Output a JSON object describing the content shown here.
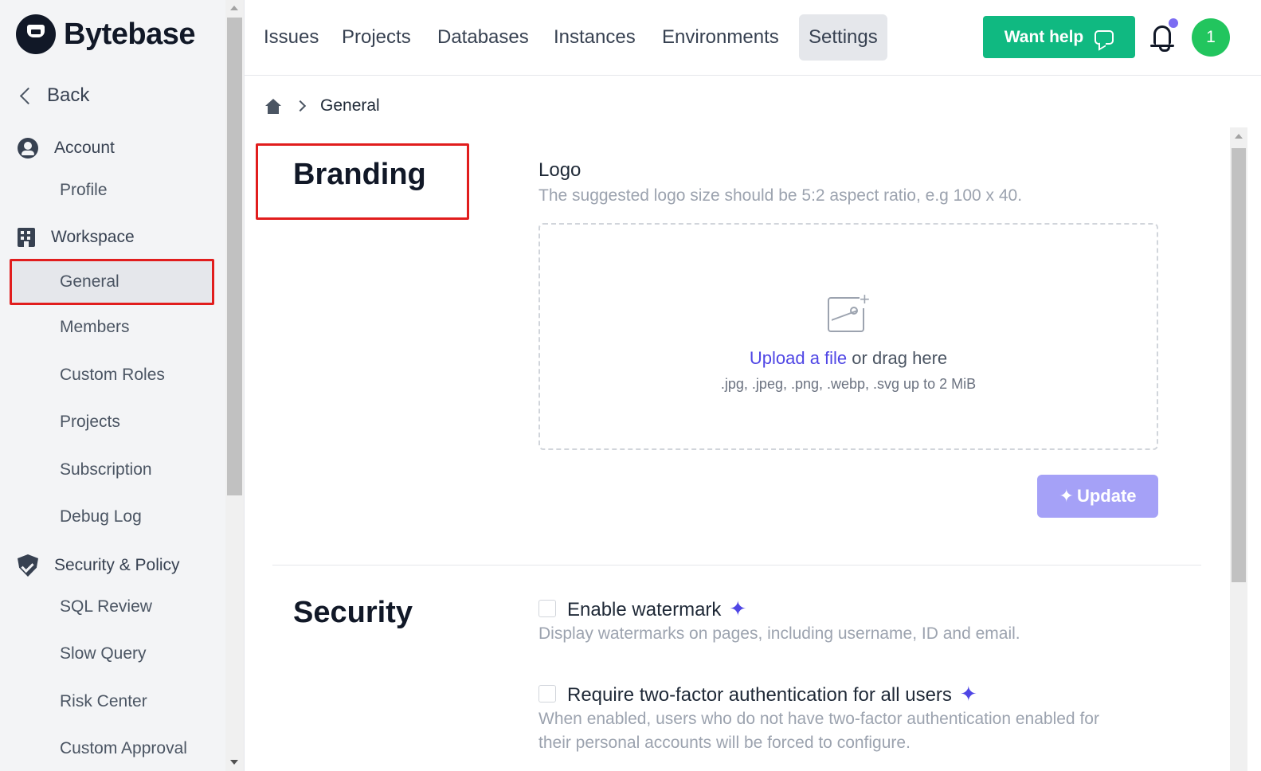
{
  "brand": {
    "name": "Bytebase"
  },
  "sidebar": {
    "back_label": "Back",
    "account_label": "Account",
    "profile_label": "Profile",
    "workspace_label": "Workspace",
    "workspace_items": [
      "General",
      "Members",
      "Custom Roles",
      "Projects",
      "Subscription",
      "Debug Log"
    ],
    "security_label": "Security & Policy",
    "security_items": [
      "SQL Review",
      "Slow Query",
      "Risk Center",
      "Custom Approval"
    ]
  },
  "topnav": {
    "items": [
      "Issues",
      "Projects",
      "Databases",
      "Instances",
      "Environments",
      "Settings"
    ],
    "active": "Settings",
    "help_label": "Want help",
    "avatar_initial": "1"
  },
  "breadcrumb": {
    "current": "General"
  },
  "branding": {
    "title": "Branding",
    "logo_label": "Logo",
    "logo_hint": "The suggested logo size should be 5:2 aspect ratio, e.g 100 x 40.",
    "upload_link": "Upload a file",
    "upload_rest": " or drag here",
    "formats": ".jpg, .jpeg, .png, .webp, .svg up to 2 MiB",
    "update_label": "Update"
  },
  "security": {
    "title": "Security",
    "watermark_label": "Enable watermark",
    "watermark_hint": "Display watermarks on pages, including username, ID and email.",
    "twofa_label": "Require two-factor authentication for all users",
    "twofa_hint_1": "When enabled, users who do not have two-factor authentication enabled for",
    "twofa_hint_2": "their personal accounts will be forced to configure."
  },
  "colors": {
    "accent": "#4f46e5",
    "help_button": "#10b981",
    "avatar": "#22c55e",
    "highlight": "#e11d1d"
  }
}
